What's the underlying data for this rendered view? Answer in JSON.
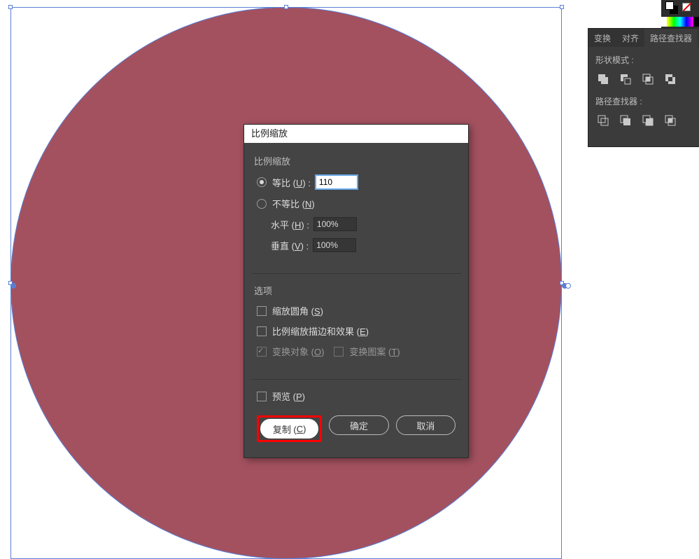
{
  "dialog": {
    "title": "比例缩放",
    "section_scale": {
      "title": "比例缩放",
      "uniform_label_pre": "等比 (",
      "uniform_hotkey": "U",
      "uniform_label_post": ") :",
      "uniform_value": "110",
      "nonuniform_label_pre": "不等比 (",
      "nonuniform_hotkey": "N",
      "nonuniform_label_post": ")",
      "h_label_pre": "水平 (",
      "h_hotkey": "H",
      "h_label_post": ") :",
      "h_value": "100%",
      "v_label_pre": "垂直 (",
      "v_hotkey": "V",
      "v_label_post": ") :",
      "v_value": "100%"
    },
    "section_options": {
      "title": "选项",
      "corners_pre": "缩放圆角 (",
      "corners_hotkey": "S",
      "corners_post": ")",
      "strokes_pre": "比例缩放描边和效果 (",
      "strokes_hotkey": "E",
      "strokes_post": ")",
      "transform_obj_pre": "变换对象 (",
      "transform_obj_hotkey": "O",
      "transform_obj_post": ")",
      "transform_pat_pre": "变换图案 (",
      "transform_pat_hotkey": "T",
      "transform_pat_post": ")"
    },
    "preview_pre": "预览 (",
    "preview_hotkey": "P",
    "preview_post": ")",
    "btn_copy_pre": "复制 (",
    "btn_copy_hotkey": "C",
    "btn_copy_post": ")",
    "btn_ok": "确定",
    "btn_cancel": "取消"
  },
  "rpanel": {
    "tab_transform": "变换",
    "tab_align": "对齐",
    "tab_pathfinder": "路径查找器",
    "label_shape_modes": "形状模式 :",
    "label_pathfinders": "路径查找器 :"
  },
  "canvas": {
    "circle_fill": "#a3515f",
    "selection_color": "#5a7fd6"
  }
}
